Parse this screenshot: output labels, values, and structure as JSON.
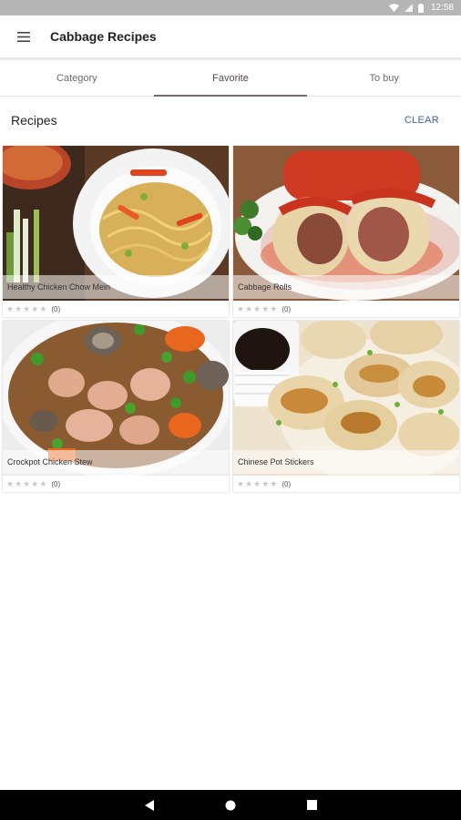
{
  "status_bar": {
    "time": "12:58"
  },
  "app_bar": {
    "title": "Cabbage Recipes",
    "menu_icon": "hamburger-menu-icon"
  },
  "tabs": [
    {
      "label": "Category",
      "active": false
    },
    {
      "label": "Favorite",
      "active": true
    },
    {
      "label": "To buy",
      "active": false
    }
  ],
  "section": {
    "title": "Recipes",
    "clear_label": "CLEAR"
  },
  "recipes": [
    {
      "name": "Healthy Chicken Chow Mein",
      "rating_count": "(0)"
    },
    {
      "name": "Cabbage Rolls",
      "rating_count": "(0)"
    },
    {
      "name": "Crockpot Chicken Stew",
      "rating_count": "(0)"
    },
    {
      "name": "Chinese Pot Stickers",
      "rating_count": "(0)"
    }
  ],
  "colors": {
    "accent": "#3f63a8",
    "tab_indicator": "#7a6a6a",
    "star": "#c8c8c8"
  }
}
